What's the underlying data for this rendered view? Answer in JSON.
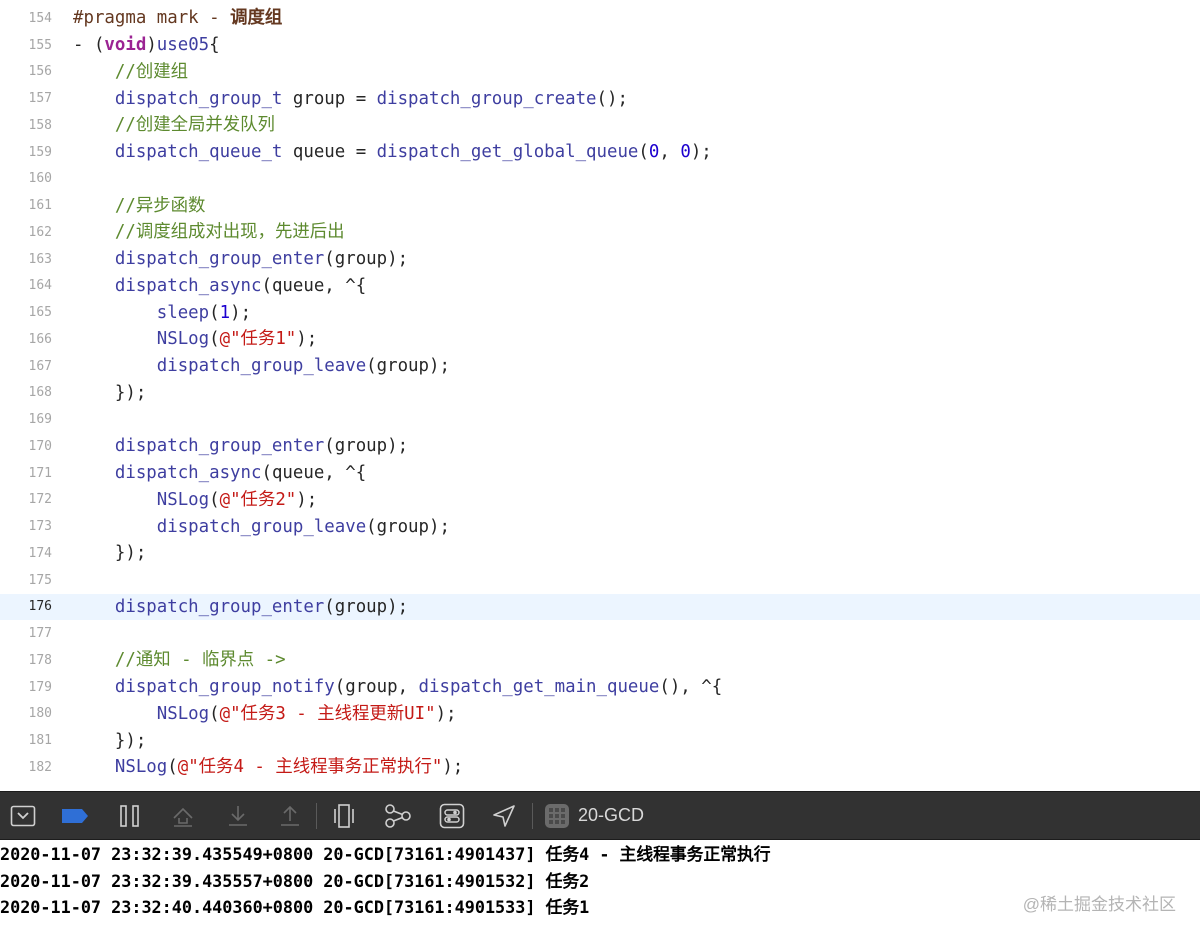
{
  "editor": {
    "lines": [
      {
        "n": "154",
        "segs": [
          {
            "c": "pp",
            "t": "#pragma mark - "
          },
          {
            "c": "pp bold",
            "t": "调度组"
          }
        ]
      },
      {
        "n": "155",
        "segs": [
          {
            "c": "pl",
            "t": "- ("
          },
          {
            "c": "kw bold",
            "t": "void"
          },
          {
            "c": "pl",
            "t": ")"
          },
          {
            "c": "fn",
            "t": "use05"
          },
          {
            "c": "pl",
            "t": "{"
          }
        ]
      },
      {
        "n": "156",
        "segs": [
          {
            "c": "cm",
            "t": "    //创建组"
          }
        ]
      },
      {
        "n": "157",
        "segs": [
          {
            "c": "fn",
            "t": "    dispatch_group_t"
          },
          {
            "c": "pl",
            "t": " group = "
          },
          {
            "c": "fn",
            "t": "dispatch_group_create"
          },
          {
            "c": "pl",
            "t": "();"
          }
        ]
      },
      {
        "n": "158",
        "segs": [
          {
            "c": "cm",
            "t": "    //创建全局并发队列"
          }
        ]
      },
      {
        "n": "159",
        "segs": [
          {
            "c": "fn",
            "t": "    dispatch_queue_t"
          },
          {
            "c": "pl",
            "t": " queue = "
          },
          {
            "c": "fn",
            "t": "dispatch_get_global_queue"
          },
          {
            "c": "pl",
            "t": "("
          },
          {
            "c": "nm",
            "t": "0"
          },
          {
            "c": "pl",
            "t": ", "
          },
          {
            "c": "nm",
            "t": "0"
          },
          {
            "c": "pl",
            "t": ");"
          }
        ]
      },
      {
        "n": "160",
        "segs": []
      },
      {
        "n": "161",
        "segs": [
          {
            "c": "cm",
            "t": "    //异步函数"
          }
        ]
      },
      {
        "n": "162",
        "segs": [
          {
            "c": "cm",
            "t": "    //调度组成对出现，先进后出"
          }
        ]
      },
      {
        "n": "163",
        "segs": [
          {
            "c": "fn",
            "t": "    dispatch_group_enter"
          },
          {
            "c": "pl",
            "t": "(group);"
          }
        ]
      },
      {
        "n": "164",
        "segs": [
          {
            "c": "fn",
            "t": "    dispatch_async"
          },
          {
            "c": "pl",
            "t": "(queue, ^{"
          }
        ]
      },
      {
        "n": "165",
        "segs": [
          {
            "c": "fn",
            "t": "        sleep"
          },
          {
            "c": "pl",
            "t": "("
          },
          {
            "c": "nm",
            "t": "1"
          },
          {
            "c": "pl",
            "t": ");"
          }
        ]
      },
      {
        "n": "166",
        "segs": [
          {
            "c": "fn",
            "t": "        NSLog"
          },
          {
            "c": "pl",
            "t": "("
          },
          {
            "c": "st",
            "t": "@\"任务1\""
          },
          {
            "c": "pl",
            "t": ");"
          }
        ]
      },
      {
        "n": "167",
        "segs": [
          {
            "c": "fn",
            "t": "        dispatch_group_leave"
          },
          {
            "c": "pl",
            "t": "(group);"
          }
        ]
      },
      {
        "n": "168",
        "segs": [
          {
            "c": "pl",
            "t": "    });"
          }
        ]
      },
      {
        "n": "169",
        "segs": []
      },
      {
        "n": "170",
        "segs": [
          {
            "c": "fn",
            "t": "    dispatch_group_enter"
          },
          {
            "c": "pl",
            "t": "(group);"
          }
        ]
      },
      {
        "n": "171",
        "segs": [
          {
            "c": "fn",
            "t": "    dispatch_async"
          },
          {
            "c": "pl",
            "t": "(queue, ^{"
          }
        ]
      },
      {
        "n": "172",
        "segs": [
          {
            "c": "fn",
            "t": "        NSLog"
          },
          {
            "c": "pl",
            "t": "("
          },
          {
            "c": "st",
            "t": "@\"任务2\""
          },
          {
            "c": "pl",
            "t": ");"
          }
        ]
      },
      {
        "n": "173",
        "segs": [
          {
            "c": "fn",
            "t": "        dispatch_group_leave"
          },
          {
            "c": "pl",
            "t": "(group);"
          }
        ]
      },
      {
        "n": "174",
        "segs": [
          {
            "c": "pl",
            "t": "    });"
          }
        ]
      },
      {
        "n": "175",
        "segs": []
      },
      {
        "n": "176",
        "current": true,
        "segs": [
          {
            "c": "fn",
            "t": "    dispatch_group_enter"
          },
          {
            "c": "pl",
            "t": "(group);"
          }
        ]
      },
      {
        "n": "177",
        "segs": []
      },
      {
        "n": "178",
        "segs": [
          {
            "c": "cm",
            "t": "    //通知 - 临界点 ->"
          }
        ]
      },
      {
        "n": "179",
        "segs": [
          {
            "c": "fn",
            "t": "    dispatch_group_notify"
          },
          {
            "c": "pl",
            "t": "(group, "
          },
          {
            "c": "fn",
            "t": "dispatch_get_main_queue"
          },
          {
            "c": "pl",
            "t": "(), ^{"
          }
        ]
      },
      {
        "n": "180",
        "segs": [
          {
            "c": "fn",
            "t": "        NSLog"
          },
          {
            "c": "pl",
            "t": "("
          },
          {
            "c": "st",
            "t": "@\"任务3 - 主线程更新UI\""
          },
          {
            "c": "pl",
            "t": ");"
          }
        ]
      },
      {
        "n": "181",
        "segs": [
          {
            "c": "pl",
            "t": "    });"
          }
        ]
      },
      {
        "n": "182",
        "segs": [
          {
            "c": "fn",
            "t": "    NSLog"
          },
          {
            "c": "pl",
            "t": "("
          },
          {
            "c": "st",
            "t": "@\"任务4 - 主线程事务正常执行\""
          },
          {
            "c": "pl",
            "t": ");"
          }
        ]
      }
    ]
  },
  "colors": {
    "comment": "#5d8a2f",
    "function": "#3e3ea0",
    "keyword": "#9b2393",
    "number": "#1c00cf",
    "string": "#c41a16",
    "preprocessor": "#643820",
    "toolbar_bg": "#323232",
    "current_line": "#ecf5ff"
  },
  "toolbar": {
    "buttons": [
      {
        "name": "hide-debug-area-button",
        "icon": "hide-debug-area-icon"
      },
      {
        "name": "breakpoints-toggle-button",
        "icon": "breakpoint-tag-icon"
      },
      {
        "name": "pause-continue-button",
        "icon": "pause-icon"
      },
      {
        "name": "step-over-button",
        "icon": "step-over-icon"
      },
      {
        "name": "step-into-button",
        "icon": "step-into-icon"
      },
      {
        "name": "step-out-button",
        "icon": "step-out-icon"
      },
      {
        "name": "debug-view-hierarchy-button",
        "icon": "view-hierarchy-icon"
      },
      {
        "name": "memory-graph-button",
        "icon": "memory-graph-icon"
      },
      {
        "name": "environment-overrides-button",
        "icon": "environment-overrides-icon"
      },
      {
        "name": "simulate-location-button",
        "icon": "location-arrow-icon"
      }
    ],
    "target": "20-GCD"
  },
  "console": {
    "lines": [
      "2020-11-07 23:32:39.435549+0800 20-GCD[73161:4901437] 任务4 - 主线程事务正常执行",
      "2020-11-07 23:32:39.435557+0800 20-GCD[73161:4901532] 任务2",
      "2020-11-07 23:32:40.440360+0800 20-GCD[73161:4901533] 任务1"
    ]
  },
  "watermark": "@稀土掘金技术社区"
}
